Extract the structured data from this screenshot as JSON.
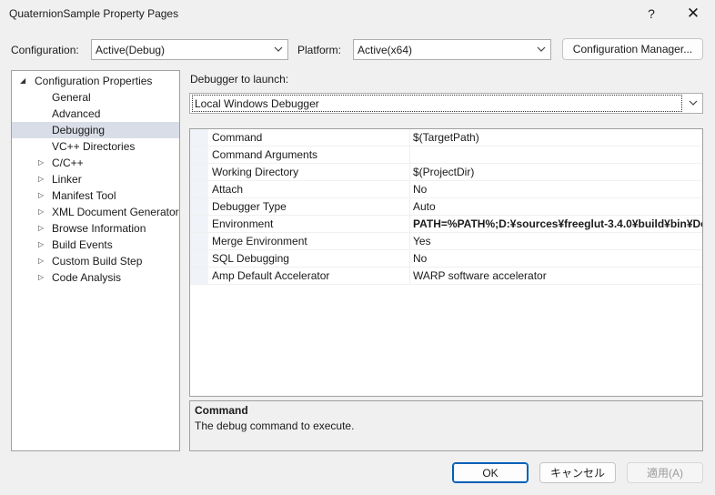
{
  "window": {
    "title": "QuaternionSample Property Pages",
    "help_label": "?",
    "close_label": "✕"
  },
  "config_bar": {
    "configuration_label": "Configuration:",
    "configuration_value": "Active(Debug)",
    "platform_label": "Platform:",
    "platform_value": "Active(x64)",
    "manager_button": "Configuration Manager..."
  },
  "tree": {
    "root": "Configuration Properties",
    "items": [
      {
        "label": "General",
        "expandable": false
      },
      {
        "label": "Advanced",
        "expandable": false
      },
      {
        "label": "Debugging",
        "expandable": false,
        "selected": true
      },
      {
        "label": "VC++ Directories",
        "expandable": false
      },
      {
        "label": "C/C++",
        "expandable": true
      },
      {
        "label": "Linker",
        "expandable": true
      },
      {
        "label": "Manifest Tool",
        "expandable": true
      },
      {
        "label": "XML Document Generator",
        "expandable": true
      },
      {
        "label": "Browse Information",
        "expandable": true
      },
      {
        "label": "Build Events",
        "expandable": true
      },
      {
        "label": "Custom Build Step",
        "expandable": true
      },
      {
        "label": "Code Analysis",
        "expandable": true
      }
    ]
  },
  "debugger": {
    "label": "Debugger to launch:",
    "value": "Local Windows Debugger"
  },
  "properties": [
    {
      "name": "Command",
      "value": "$(TargetPath)",
      "bold": false
    },
    {
      "name": "Command Arguments",
      "value": "",
      "bold": false
    },
    {
      "name": "Working Directory",
      "value": "$(ProjectDir)",
      "bold": false
    },
    {
      "name": "Attach",
      "value": "No",
      "bold": false
    },
    {
      "name": "Debugger Type",
      "value": "Auto",
      "bold": false
    },
    {
      "name": "Environment",
      "value": "PATH=%PATH%;D:¥sources¥freeglut-3.4.0¥build¥bin¥Deb",
      "bold": true
    },
    {
      "name": "Merge Environment",
      "value": "Yes",
      "bold": false
    },
    {
      "name": "SQL Debugging",
      "value": "No",
      "bold": false
    },
    {
      "name": "Amp Default Accelerator",
      "value": "WARP software accelerator",
      "bold": false
    }
  ],
  "description": {
    "title": "Command",
    "text": "The debug command to execute."
  },
  "buttons": {
    "ok": "OK",
    "cancel": "キャンセル",
    "apply": "適用(A)"
  },
  "colors": {
    "selection": "#d9dde7",
    "ok_border": "#005fb8"
  }
}
